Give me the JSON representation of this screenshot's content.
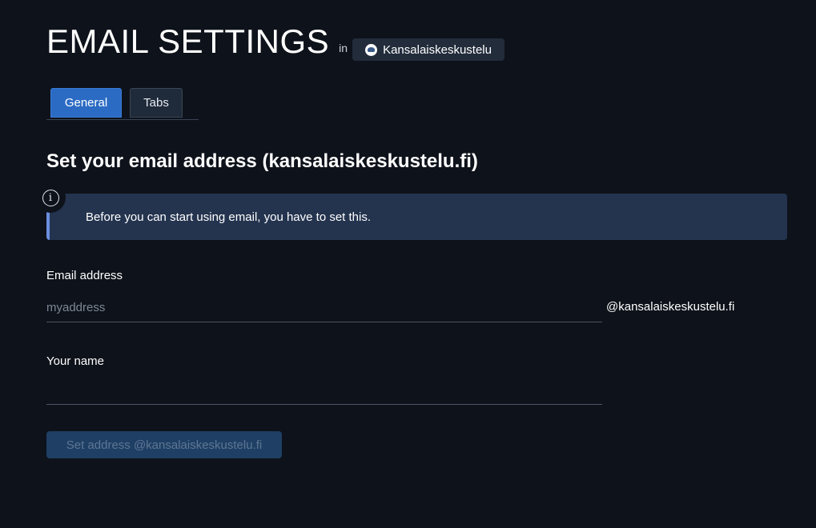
{
  "header": {
    "title": "EMAIL SETTINGS",
    "in_label": "in",
    "room_name": "Kansalaiskeskustelu",
    "room_icon": "room-avatar-icon"
  },
  "tabs": [
    {
      "label": "General",
      "active": true
    },
    {
      "label": "Tabs",
      "active": false
    }
  ],
  "section": {
    "heading": "Set your email address (kansalaiskeskustelu.fi)",
    "info_icon": "info-icon",
    "info_text": "Before you can start using email, you have to set this."
  },
  "form": {
    "email_label": "Email address",
    "email_placeholder": "myaddress",
    "email_value": "",
    "email_suffix": "@kansalaiskeskustelu.fi",
    "name_label": "Your name",
    "name_value": "",
    "submit_label": "Set address @kansalaiskeskustelu.fi",
    "submit_disabled": true
  },
  "colors": {
    "background": "#0e121a",
    "accent": "#2b6bc4",
    "info_bg": "#24344f",
    "info_border": "#6a8fe0",
    "disabled_button_bg": "#1f3f64",
    "disabled_button_text": "#5d7694"
  }
}
